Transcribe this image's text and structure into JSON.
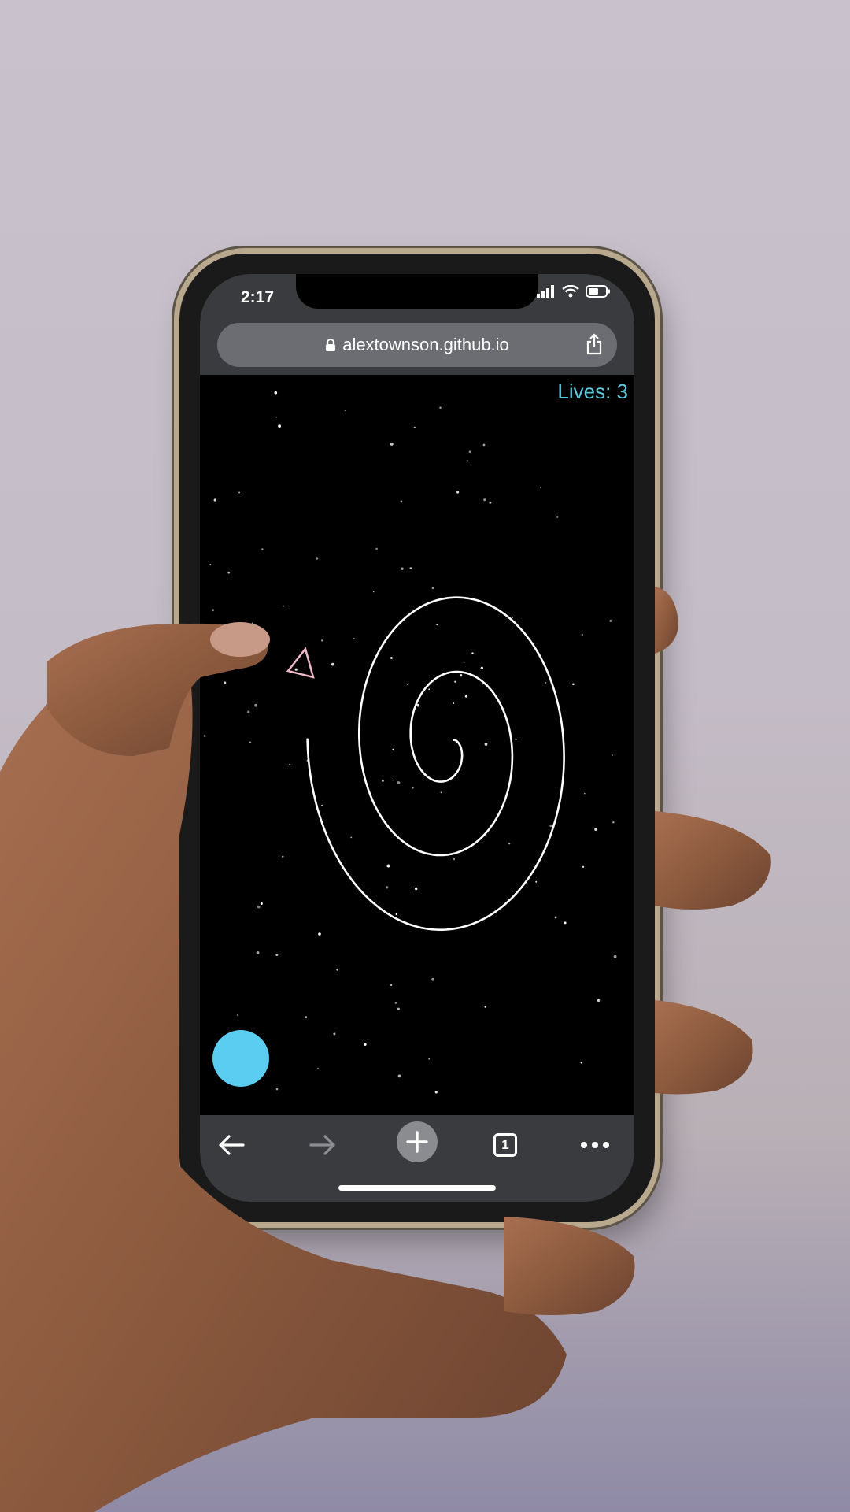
{
  "status_bar": {
    "time": "2:17"
  },
  "browser": {
    "url": "alextownson.github.io",
    "tab_count": "1",
    "icons": [
      "lock-icon",
      "share-icon",
      "back-arrow-icon",
      "forward-arrow-icon",
      "plus-icon",
      "tabs-icon",
      "more-icon"
    ]
  },
  "game": {
    "lives_label": "Lives: 3",
    "colors": {
      "lives": "#5ec9dc",
      "joystick": "#5bcdf0",
      "ship": "#f0b8c8",
      "spiral": "#ffffff",
      "background": "#000000"
    }
  }
}
